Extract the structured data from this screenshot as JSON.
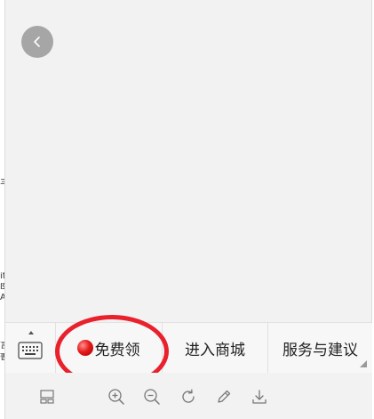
{
  "left_strip": {
    "chars": [
      "亖",
      "it",
      "ß",
      "Ã",
      "言",
      "書"
    ]
  },
  "nav": {
    "back_icon": "chevron-left-icon"
  },
  "menu": {
    "keyboard_icon": "keyboard-icon",
    "items": [
      {
        "label": "免费领",
        "icon": "red-dot-icon",
        "highlighted": true
      },
      {
        "label": "进入商城"
      },
      {
        "label": "服务与建议",
        "has_submenu": true
      }
    ]
  },
  "toolbar": {
    "tools": [
      "layout-icon",
      "zoom-in-icon",
      "zoom-out-icon",
      "rotate-icon",
      "edit-icon",
      "download-icon"
    ]
  },
  "colors": {
    "highlight": "#e8212d",
    "accent_dot": "#e61b1b",
    "background": "#f2f2f2"
  }
}
